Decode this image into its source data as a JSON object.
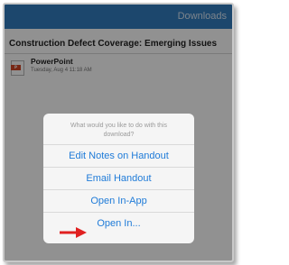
{
  "topbar": {
    "tab_label": "Downloads"
  },
  "document": {
    "title": "Construction Defect Coverage: Emerging Issues",
    "file": {
      "name": "PowerPoint",
      "date": "Tuesday, Aug 4 11:18 AM",
      "icon": "powerpoint-file-icon"
    }
  },
  "dialog": {
    "prompt": "What would you like to do with this download?",
    "options": [
      {
        "label": "Edit Notes on Handout"
      },
      {
        "label": "Email Handout"
      },
      {
        "label": "Open In-App"
      },
      {
        "label": "Open In..."
      }
    ]
  },
  "annotation": {
    "arrow_color": "#e02020"
  },
  "colors": {
    "topbar": "#327dc0",
    "option_text": "#1f7bd8"
  }
}
